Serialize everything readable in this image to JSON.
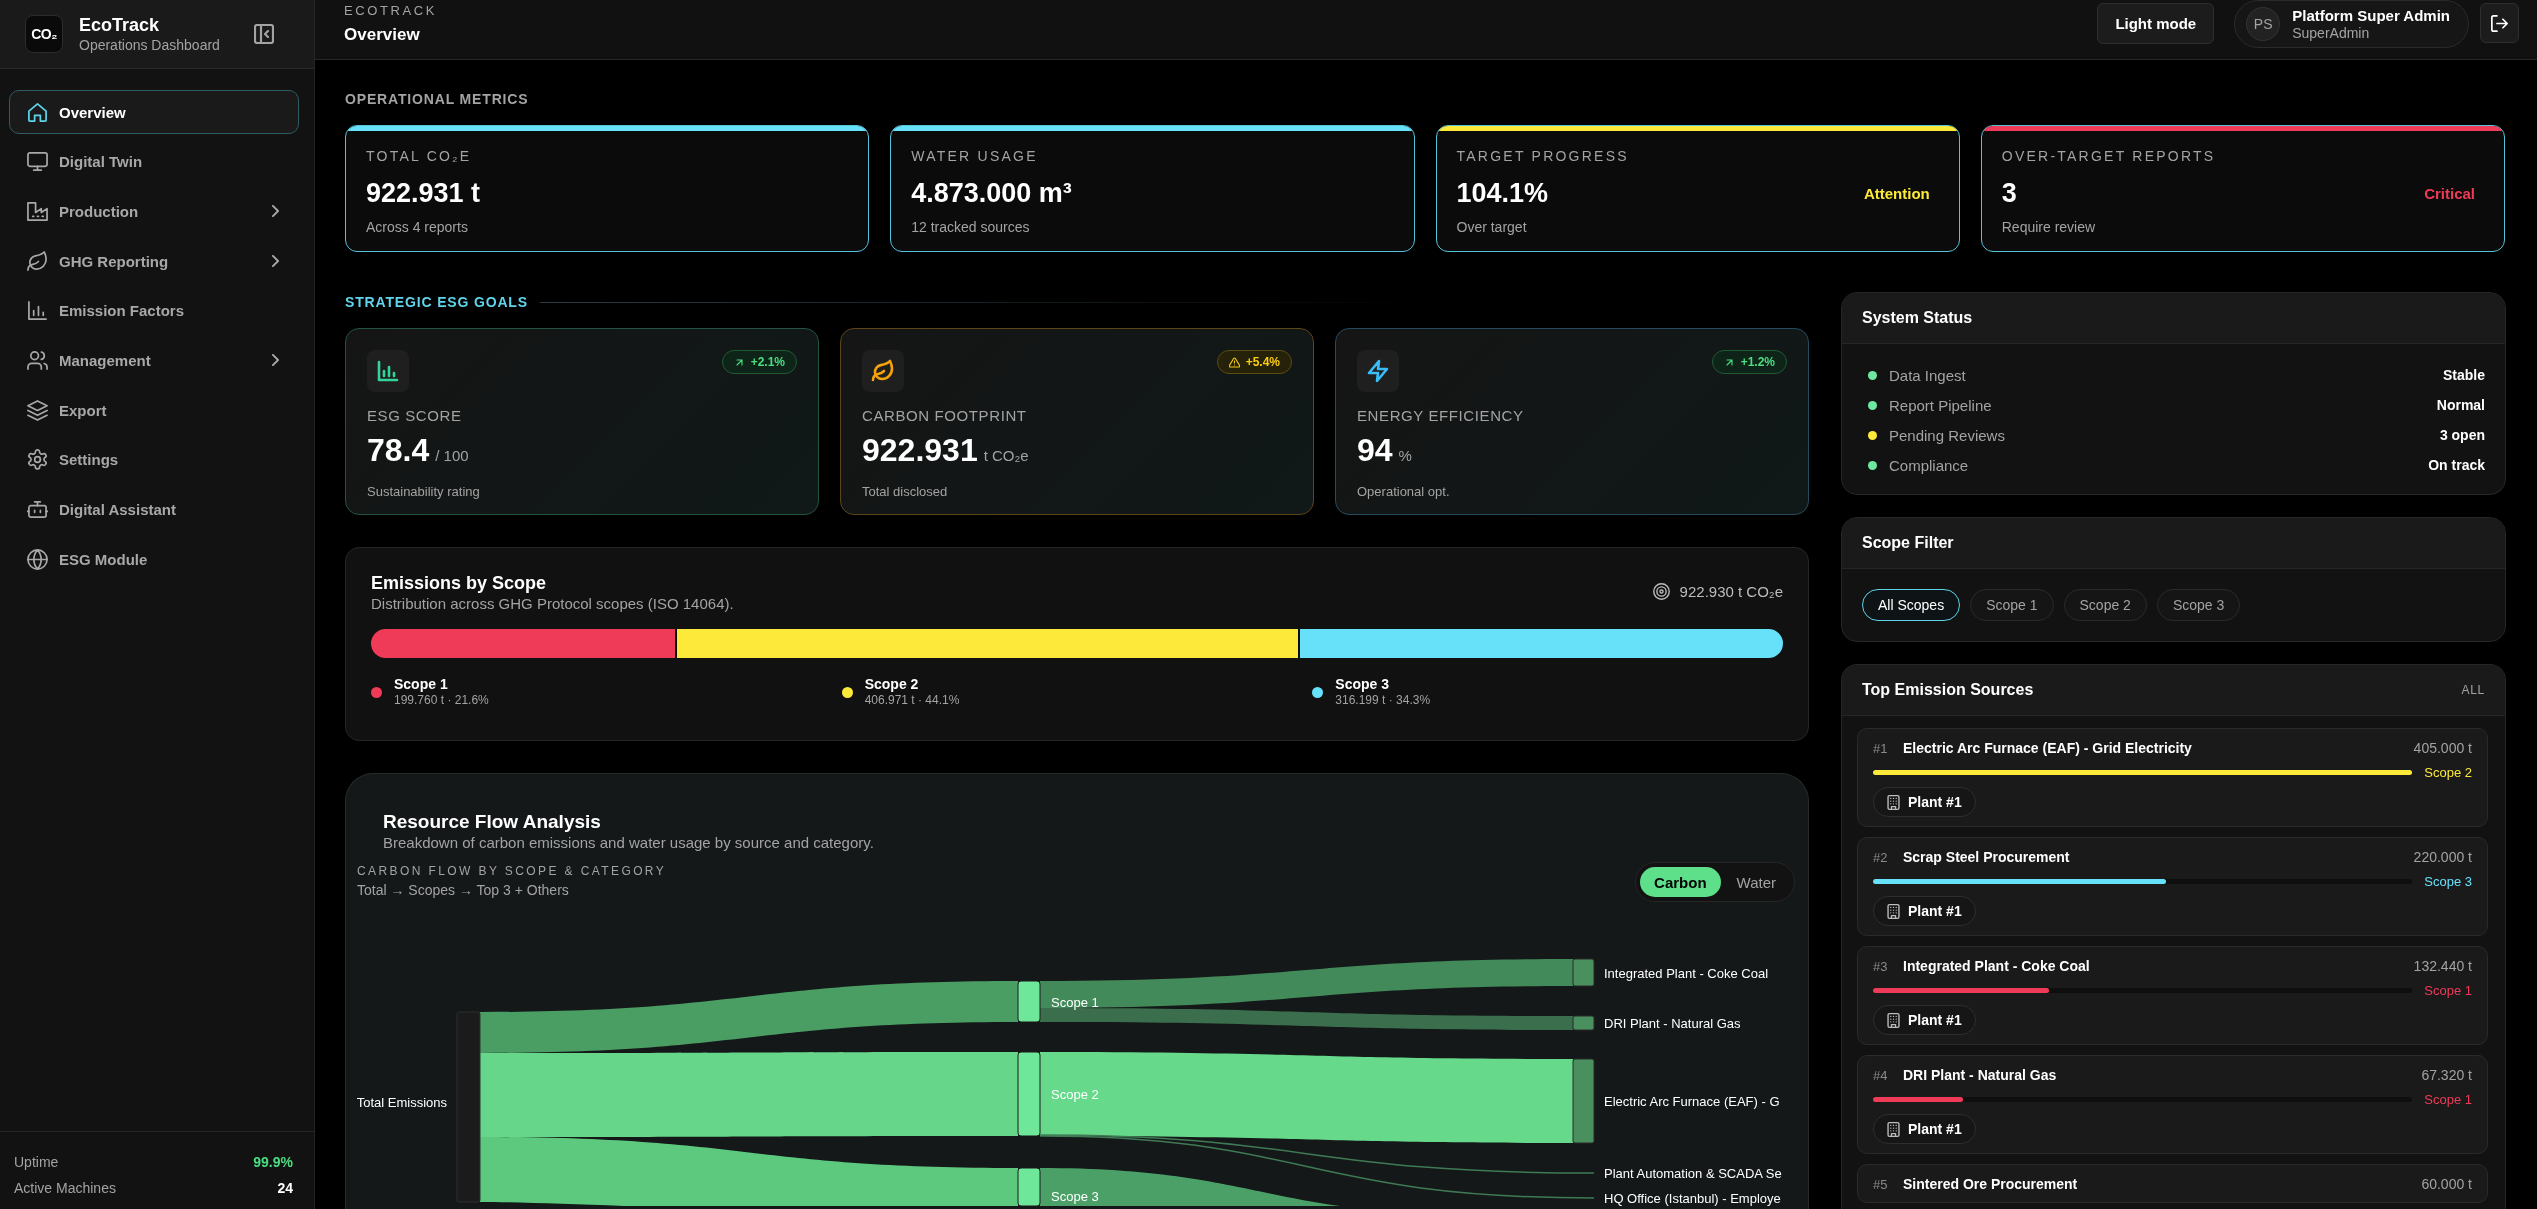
{
  "sidebar": {
    "logo": "CO₂",
    "name": "EcoTrack",
    "subtitle": "Operations Dashboard",
    "items": [
      {
        "label": "Overview",
        "selected": true,
        "has_submenu": false
      },
      {
        "label": "Digital Twin",
        "selected": false,
        "has_submenu": false
      },
      {
        "label": "Production",
        "selected": false,
        "has_submenu": true
      },
      {
        "label": "GHG Reporting",
        "selected": false,
        "has_submenu": true
      },
      {
        "label": "Emission Factors",
        "selected": false,
        "has_submenu": false
      },
      {
        "label": "Management",
        "selected": false,
        "has_submenu": true
      },
      {
        "label": "Export",
        "selected": false,
        "has_submenu": false
      },
      {
        "label": "Settings",
        "selected": false,
        "has_submenu": false
      },
      {
        "label": "Digital Assistant",
        "selected": false,
        "has_submenu": false
      },
      {
        "label": "ESG Module",
        "selected": false,
        "has_submenu": false
      }
    ],
    "footer": [
      {
        "label": "Uptime",
        "value": "99.9%",
        "color": "#4ade80"
      },
      {
        "label": "Active Machines",
        "value": "24",
        "color": "#ffffff"
      }
    ]
  },
  "topbar": {
    "eyebrow": "ECOTRACK",
    "title": "Overview",
    "theme_button": "Light mode",
    "user": {
      "initials": "PS",
      "name": "Platform Super Admin",
      "role": "SuperAdmin"
    }
  },
  "operational_metrics": {
    "heading": "OPERATIONAL METRICS",
    "cards": [
      {
        "label": "TOTAL CO₂E",
        "value": "922.931 t",
        "note": "Across 4 reports",
        "color": "#67e0fa"
      },
      {
        "label": "WATER USAGE",
        "value": "4.873.000 m³",
        "note": "12 tracked sources",
        "color": "#67e0fa"
      },
      {
        "label": "TARGET PROGRESS",
        "value": "104.1%",
        "note": "Over target",
        "status": "Attention",
        "color": "#fde93a"
      },
      {
        "label": "OVER-TARGET REPORTS",
        "value": "3",
        "note": "Require review",
        "status": "Critical",
        "color": "#ef3b58"
      }
    ]
  },
  "strategic_goals": {
    "heading": "STRATEGIC ESG GOALS",
    "cards": [
      {
        "label": "ESG SCORE",
        "value": "78.4",
        "unit": "/ 100",
        "note": "Sustainability rating",
        "color": "#34d399",
        "badge": {
          "kind": "up",
          "text": "+2.1%"
        }
      },
      {
        "label": "CARBON FOOTPRINT",
        "value": "922.931",
        "unit": "t CO₂e",
        "note": "Total disclosed",
        "color": "#f5a30b",
        "badge": {
          "kind": "warning",
          "text": "+5.4%"
        }
      },
      {
        "label": "ENERGY EFFICIENCY",
        "value": "94",
        "unit": "%",
        "note": "Operational opt.",
        "color": "#38bdf8",
        "badge": {
          "kind": "up",
          "text": "+1.2%"
        }
      }
    ]
  },
  "emissions_by_scope": {
    "title": "Emissions by Scope",
    "subtitle": "Distribution across GHG Protocol scopes (ISO 14064).",
    "total": "922.930 t CO₂e",
    "scopes": [
      {
        "name": "Scope 1",
        "detail": "199.760 t · 21.6%",
        "level": 0.216,
        "color": "#ef3b58"
      },
      {
        "name": "Scope 2",
        "detail": "406.971 t · 44.1%",
        "level": 0.441,
        "color": "#fde93a"
      },
      {
        "name": "Scope 3",
        "detail": "316.199 t · 34.3%",
        "level": 0.343,
        "color": "#67e0fa"
      }
    ]
  },
  "resource_flow": {
    "title": "Resource Flow Analysis",
    "subtitle": "Breakdown of carbon emissions and water usage by source and category.",
    "chart_title": "CARBON FLOW BY SCOPE & CATEGORY",
    "chart_path": "Total → Scopes → Top 3 + Others",
    "modes": [
      {
        "label": "Carbon",
        "selected": true
      },
      {
        "label": "Water",
        "selected": false
      }
    ],
    "sankey": {
      "source": "Total Emissions",
      "scopes": [
        "Scope 1",
        "Scope 2",
        "Scope 3"
      ],
      "targets": [
        "Integrated Plant - Coke Coal",
        "DRI Plant - Natural Gas",
        "Electric Arc Furnace (EAF) - G",
        "Plant Automation & SCADA Se",
        "HQ Office (Istanbul) - Employe"
      ]
    }
  },
  "system_status": {
    "title": "System Status",
    "items": [
      {
        "label": "Data Ingest",
        "value": "Stable",
        "color": "#6ee7a0"
      },
      {
        "label": "Report Pipeline",
        "value": "Normal",
        "color": "#6ee7a0"
      },
      {
        "label": "Pending Reviews",
        "value": "3 open",
        "color": "#fde93a"
      },
      {
        "label": "Compliance",
        "value": "On track",
        "color": "#6ee7a0"
      }
    ]
  },
  "scope_filter": {
    "title": "Scope Filter",
    "options": [
      {
        "label": "All Scopes",
        "selected": true
      },
      {
        "label": "Scope 1",
        "selected": false
      },
      {
        "label": "Scope 2",
        "selected": false
      },
      {
        "label": "Scope 3",
        "selected": false
      }
    ]
  },
  "top_sources": {
    "title": "Top Emission Sources",
    "action": "ALL",
    "items": [
      {
        "rank": "#1",
        "name": "Electric Arc Furnace (EAF) - Grid Electricity",
        "amount": "405.000 t",
        "level": 1.0,
        "scope": "Scope 2",
        "color": "#fde93a",
        "site": "Plant #1"
      },
      {
        "rank": "#2",
        "name": "Scrap Steel Procurement",
        "amount": "220.000 t",
        "level": 0.543,
        "scope": "Scope 3",
        "color": "#67e0fa",
        "site": "Plant #1"
      },
      {
        "rank": "#3",
        "name": "Integrated Plant - Coke Coal",
        "amount": "132.440 t",
        "level": 0.327,
        "scope": "Scope 1",
        "color": "#ef3b58",
        "site": "Plant #1"
      },
      {
        "rank": "#4",
        "name": "DRI Plant - Natural Gas",
        "amount": "67.320 t",
        "level": 0.166,
        "scope": "Scope 1",
        "color": "#ef3b58",
        "site": "Plant #1"
      },
      {
        "rank": "#5",
        "name": "Sintered Ore Procurement",
        "amount": "60.000 t"
      }
    ]
  }
}
